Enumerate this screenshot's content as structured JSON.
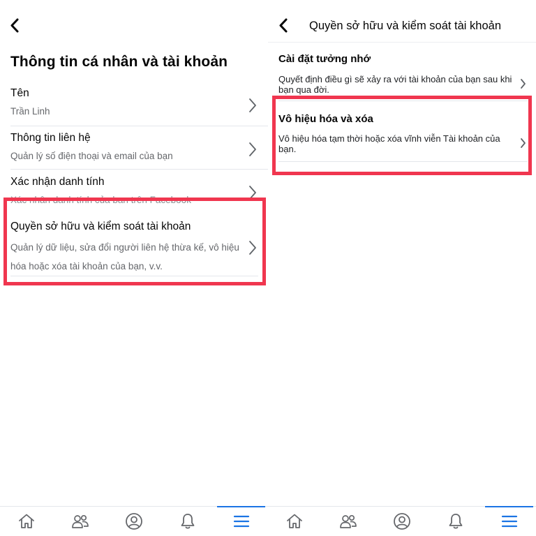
{
  "left_screen": {
    "title": "Thông tin cá nhân và tài khoản",
    "rows": [
      {
        "title": "Tên",
        "subtitle": "Trần Linh"
      },
      {
        "title": "Thông tin liên hệ",
        "subtitle": "Quản lý số điện thoại và email của bạn"
      },
      {
        "title": "Xác nhận danh tính",
        "subtitle": "Xác nhận danh tính của bạn trên Facebook"
      },
      {
        "title": "Quyền sở hữu và kiểm soát tài khoản",
        "subtitle": "Quản lý dữ liệu, sửa đổi người liên hệ thừa kế, vô hiệu hóa hoặc xóa tài khoản của bạn, v.v."
      }
    ]
  },
  "right_screen": {
    "header_title": "Quyền sở hữu và kiểm soát tài khoản",
    "rows": [
      {
        "title": "Cài đặt tưởng nhớ",
        "subtitle": "Quyết định điều gì sẽ xảy ra với tài khoản của bạn sau khi bạn qua đời."
      },
      {
        "title": "Vô hiệu hóa và xóa",
        "subtitle": "Vô hiệu hóa tạm thời hoặc xóa vĩnh viễn Tài khoản của bạn."
      }
    ]
  },
  "tabbar": {
    "tabs": [
      "home-icon",
      "friends-icon",
      "profile-icon",
      "notifications-icon",
      "menu-icon"
    ],
    "active": "menu-icon"
  },
  "colors": {
    "highlight": "#f0364f",
    "active_tab": "#1b74e4",
    "secondary_text": "#65676b",
    "icon": "#65676b"
  }
}
